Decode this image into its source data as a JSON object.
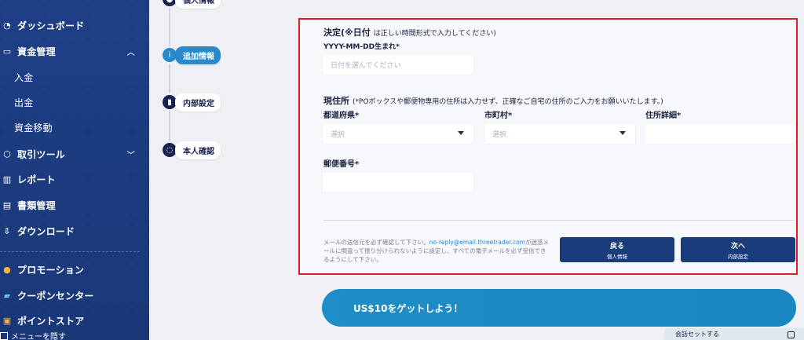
{
  "sidebar": {
    "items": [
      {
        "label": "ダッシュボード",
        "icon": "gauge-icon"
      },
      {
        "label": "資金管理",
        "icon": "wallet-icon",
        "expanded": true
      },
      {
        "label": "入金"
      },
      {
        "label": "出金"
      },
      {
        "label": "資金移動"
      },
      {
        "label": "取引ツール",
        "icon": "tools-icon",
        "expanded": false
      },
      {
        "label": "レポート",
        "icon": "report-icon"
      },
      {
        "label": "書類管理",
        "icon": "documents-icon"
      },
      {
        "label": "ダウンロード",
        "icon": "download-icon"
      },
      {
        "label": "プロモーション",
        "icon": "drop-icon"
      },
      {
        "label": "クーポンセンター",
        "icon": "coupon-icon"
      },
      {
        "label": "ポイントストア",
        "icon": "gift-icon"
      }
    ],
    "hide_menu": "メニューを隠す"
  },
  "steps": [
    {
      "label": "個人情報",
      "state": "done"
    },
    {
      "label": "追加情報",
      "state": "active"
    },
    {
      "label": "内部設定",
      "state": "todo"
    },
    {
      "label": "本人確認",
      "state": "todo"
    }
  ],
  "form": {
    "date_heading": "決定(※日付",
    "date_note": "は正しい時間形式で入力してください)",
    "dob_label": "YYYY-MM-DD生まれ*",
    "dob_placeholder": "日付を選んでください",
    "address_heading": "現住所",
    "address_note": "(*POボックスや郵便物専用の住所は入力せず、正確なご自宅の住所のご入力をお願いいたします。)",
    "prefecture_label": "都道府県*",
    "prefecture_value": "選択",
    "city_label": "市町村*",
    "city_value": "選択",
    "address_detail_label": "住所詳細*",
    "postal_label": "郵便番号*",
    "notice_before": "メールの送信元を必ず確認して下さい。",
    "notice_email": "no-reply@email.threetrader.com",
    "notice_after": "が迷惑メールに間違って振り分けられないように設定し、すべての電子メールを必ず受信できるようにして下さい。",
    "back_button": {
      "main": "戻る",
      "sub": "個人情報"
    },
    "next_button": {
      "main": "次へ",
      "sub": "内部設定"
    }
  },
  "promo": {
    "label": "US$10をゲットしよう！"
  },
  "chat": {
    "label": "会話セットする"
  },
  "colors": {
    "sidebar": "#1d3f86",
    "accent": "#2a89c9",
    "highlight_border": "#d81f26",
    "button": "#1b3c7b"
  }
}
